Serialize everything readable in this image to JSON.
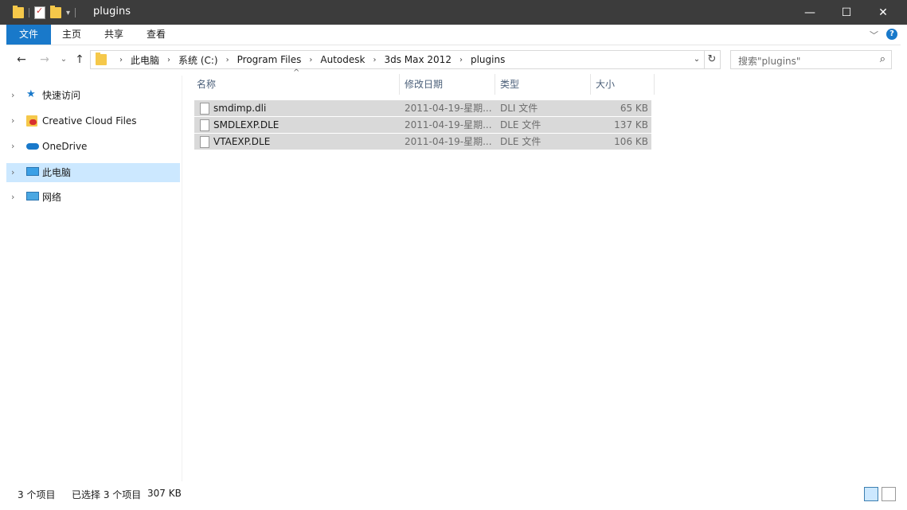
{
  "window": {
    "title": "plugins"
  },
  "ribbon": {
    "tabs": [
      "文件",
      "主页",
      "共享",
      "查看"
    ]
  },
  "address": {
    "crumbs": [
      "此电脑",
      "系统 (C:)",
      "Program Files",
      "Autodesk",
      "3ds Max 2012",
      "plugins"
    ]
  },
  "search": {
    "placeholder": "搜索\"plugins\""
  },
  "nav": {
    "items": [
      {
        "label": "快速访问",
        "icon": "star-icon"
      },
      {
        "label": "Creative Cloud Files",
        "icon": "creative-cloud-icon"
      },
      {
        "label": "OneDrive",
        "icon": "cloud-icon"
      },
      {
        "label": "此电脑",
        "icon": "computer-icon",
        "selected": true
      },
      {
        "label": "网络",
        "icon": "network-icon"
      }
    ]
  },
  "columns": {
    "name": "名称",
    "date": "修改日期",
    "type": "类型",
    "size": "大小"
  },
  "files": [
    {
      "name": "smdimp.dli",
      "date": "2011-04-19-星期...",
      "type": "DLI 文件",
      "size": "65 KB"
    },
    {
      "name": "SMDLEXP.DLE",
      "date": "2011-04-19-星期...",
      "type": "DLE 文件",
      "size": "137 KB"
    },
    {
      "name": "VTAEXP.DLE",
      "date": "2011-04-19-星期...",
      "type": "DLE 文件",
      "size": "106 KB"
    }
  ],
  "status": {
    "count": "3 个项目",
    "selected": "已选择 3 个项目",
    "size": "307 KB"
  },
  "colors": {
    "accent": "#1979ca",
    "selection": "#cce8ff",
    "rowSelected": "#d9d9d9",
    "titlebar": "#3c3c3c"
  }
}
